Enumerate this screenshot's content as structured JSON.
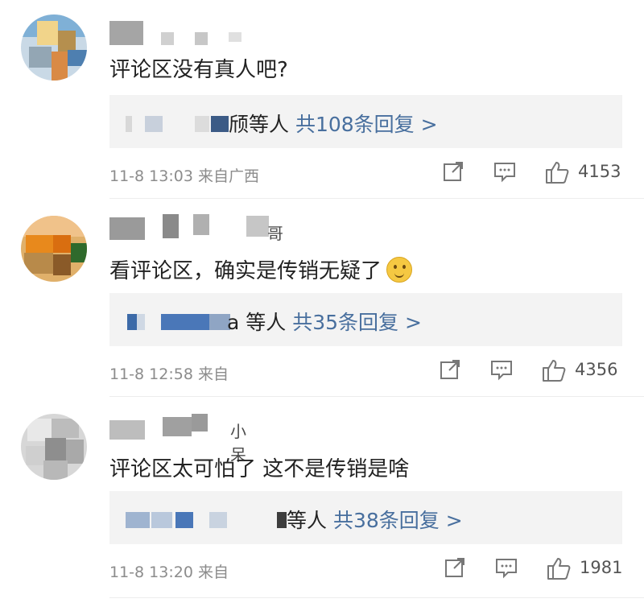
{
  "comments": [
    {
      "name_partial": "",
      "text": "评论区没有真人吧?",
      "replies": {
        "name_suffix": "颀等人",
        "count_label": "共108条回复 >"
      },
      "time": "11-8 13:03",
      "location": "来自广西",
      "likes": "4153"
    },
    {
      "name_partial": "哥",
      "text": "看评论区，确实是传销无疑了",
      "emoji": "thinking-emoji",
      "replies": {
        "name_suffix": "a 等人",
        "count_label": "共35条回复 >"
      },
      "time": "11-8 12:58",
      "location": "来自",
      "likes": "4356"
    },
    {
      "name_partial": "小呆",
      "text": "评论区太可怕了 这不是传销是啥",
      "replies": {
        "name_suffix": "等人",
        "count_label": "共38条回复 >"
      },
      "time": "11-8 13:20",
      "location": "来自",
      "likes": "1981"
    }
  ],
  "icons": [
    "share-icon",
    "comment-icon",
    "like-icon"
  ],
  "colors": {
    "link": "#486f9e",
    "meta": "#8c8c8c",
    "reply_bg": "#f3f3f3"
  }
}
